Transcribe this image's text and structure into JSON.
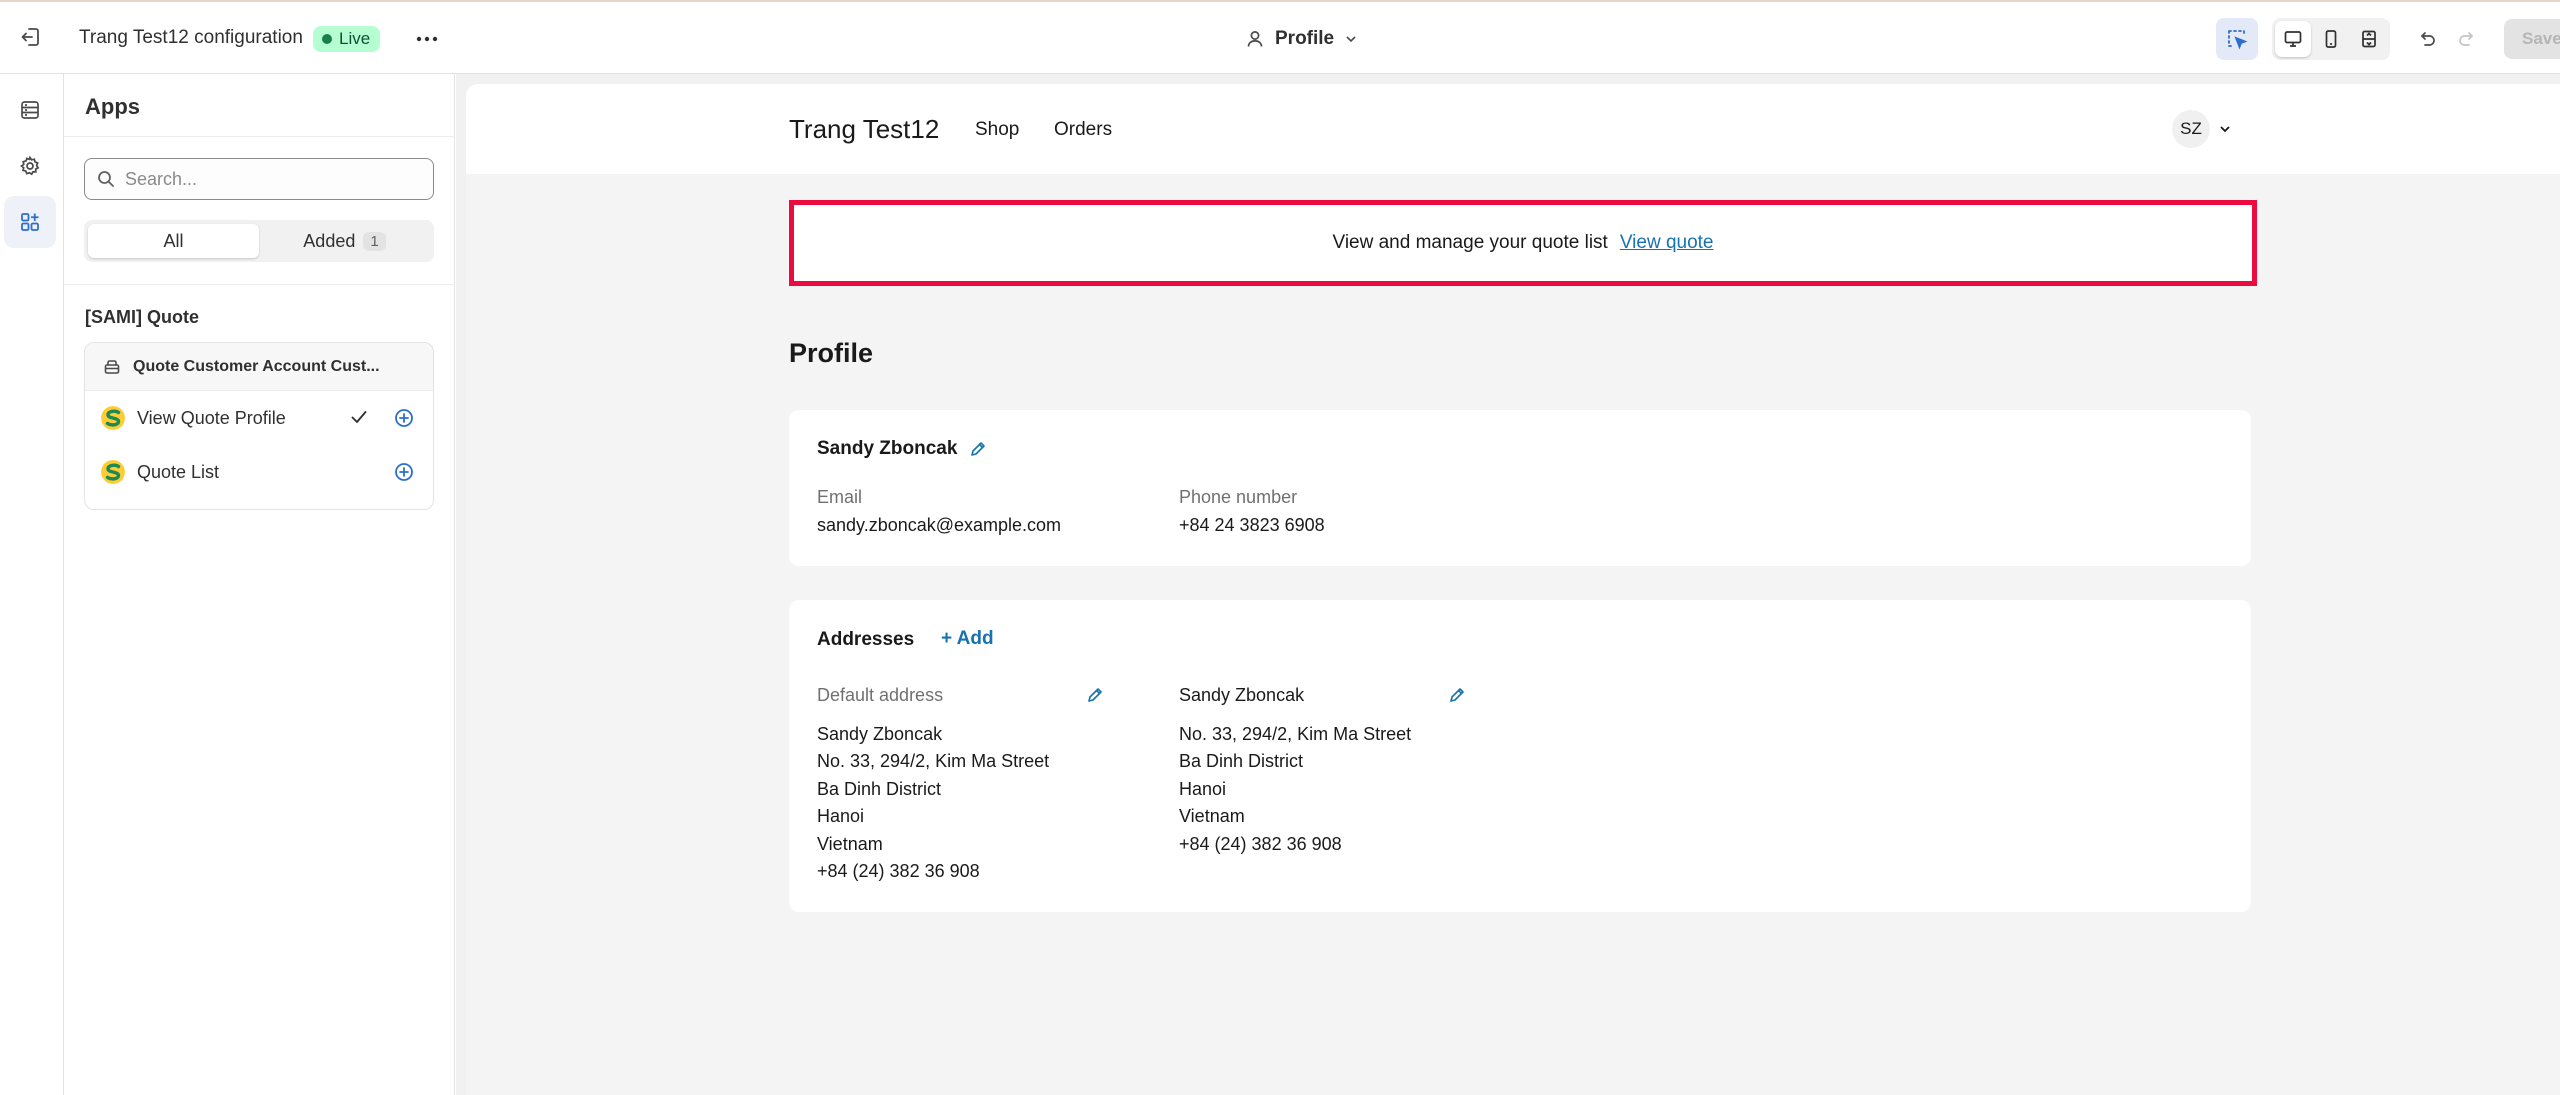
{
  "topbar": {
    "title": "Trang Test12 configuration",
    "status": "Live",
    "template": "Profile",
    "save_label": "Save"
  },
  "panel": {
    "title": "Apps",
    "search_placeholder": "Search...",
    "filter_all": "All",
    "filter_added": "Added",
    "added_count": "1",
    "group_title": "[SAMI] Quote",
    "app_name": "Quote Customer Account Cust...",
    "blocks": [
      {
        "label": "View Quote Profile",
        "added": true
      },
      {
        "label": "Quote List",
        "added": false
      }
    ]
  },
  "store": {
    "name": "Trang Test12",
    "nav": [
      "Shop",
      "Orders"
    ],
    "avatar_initials": "SZ"
  },
  "banner": {
    "text": "View and manage your quote list",
    "link": "View quote",
    "border_color": "#ec0b3e"
  },
  "profile": {
    "heading": "Profile",
    "name": "Sandy Zboncak",
    "email_label": "Email",
    "email": "sandy.zboncak@example.com",
    "phone_label": "Phone number",
    "phone": "+84 24 3823 6908"
  },
  "addresses": {
    "title": "Addresses",
    "add_label": "+ Add",
    "default_label": "Default address",
    "default_lines": [
      "Sandy Zboncak",
      "No. 33, 294/2, Kim Ma Street",
      "Ba Dinh District",
      "Hanoi",
      "Vietnam",
      "+84 (24) 382 36 908"
    ],
    "second_name": "Sandy Zboncak",
    "second_lines": [
      "No. 33, 294/2, Kim Ma Street",
      "Ba Dinh District",
      "Hanoi",
      "Vietnam",
      "+84 (24) 382 36 908"
    ]
  },
  "icons": {
    "exit": "exit-icon",
    "more": "more-horizontal-icon",
    "person": "person-icon",
    "chevron": "chevron-down-icon",
    "select": "element-select-icon",
    "desktop": "desktop-icon",
    "mobile": "mobile-icon",
    "fullwidth": "full-width-icon",
    "undo": "undo-icon",
    "redo": "redo-icon",
    "sections": "sections-icon",
    "settings": "gear-icon",
    "apps": "apps-icon",
    "search": "search-icon",
    "block": "app-block-icon",
    "check": "checkmark-icon",
    "plus": "plus-circle-icon",
    "edit": "pencil-icon"
  },
  "colors": {
    "link": "#1773b0",
    "live_bg": "#b4fed2",
    "accent": "#2c6ecb"
  }
}
